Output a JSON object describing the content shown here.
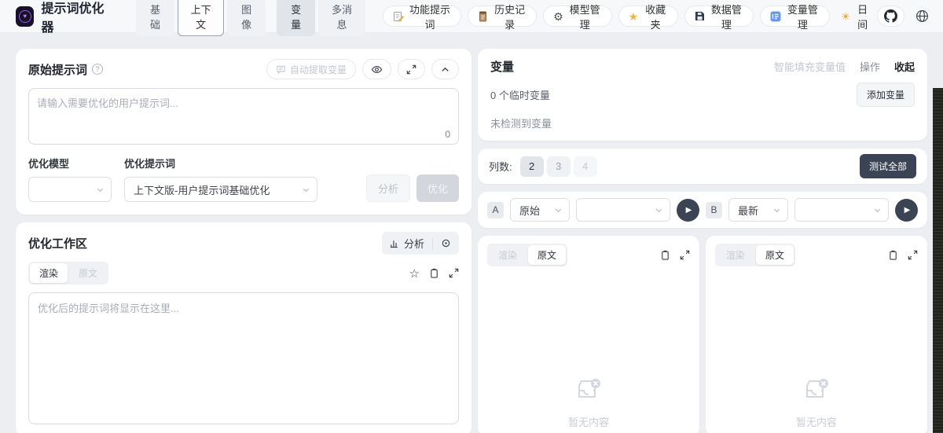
{
  "header": {
    "app_title": "提示词优化器",
    "mode_tabs": [
      {
        "label": "基础"
      },
      {
        "label": "上下文"
      },
      {
        "label": "图像"
      }
    ],
    "sub_tabs": [
      {
        "label": "变量"
      },
      {
        "label": "多消息"
      }
    ],
    "actions": [
      {
        "label": "功能提示词",
        "icon": "memo-pencil-icon"
      },
      {
        "label": "历史记录",
        "icon": "scroll-icon"
      },
      {
        "label": "模型管理",
        "icon": "gear-icon"
      },
      {
        "label": "收藏夹",
        "icon": "star-icon"
      },
      {
        "label": "数据管理",
        "icon": "floppy-icon"
      },
      {
        "label": "变量管理",
        "icon": "input-numbers-icon"
      }
    ],
    "theme_label": "日间"
  },
  "original_prompt": {
    "title": "原始提示词",
    "auto_extract_label": "自动提取变量",
    "textarea_placeholder": "请输入需要优化的用户提示词...",
    "char_count": "0",
    "model_label": "优化模型",
    "model_value": "",
    "template_label": "优化提示词",
    "template_value": "上下文版-用户提示词基础优化",
    "analyze_label": "分析",
    "optimize_label": "优化"
  },
  "workspace": {
    "title": "优化工作区",
    "analyze_label": "分析",
    "tab_render": "渲染",
    "tab_source": "原文",
    "textarea_placeholder": "优化后的提示词将显示在这里..."
  },
  "variables": {
    "title": "变量",
    "smart_fill_label": "智能填充变量值",
    "actions_label": "操作",
    "collapse_label": "收起",
    "temp_count_text": "0 个临时变量",
    "add_button_label": "添加变量",
    "empty_text": "未检测到变量"
  },
  "columns": {
    "label": "列数:",
    "options": [
      "2",
      "3",
      "4"
    ],
    "active_option": "2",
    "test_all_label": "测试全部"
  },
  "compare": {
    "a": {
      "badge": "A",
      "version": "原始"
    },
    "b": {
      "badge": "B",
      "version": "最新"
    },
    "tab_render": "渲染",
    "tab_source": "原文",
    "empty_text": "暂无内容"
  },
  "colors": {
    "accent_dark": "#3a4454",
    "logo_purple": "#8b5cf6",
    "page_bg": "#eceef2",
    "disabled_text": "#c3c7cf"
  }
}
